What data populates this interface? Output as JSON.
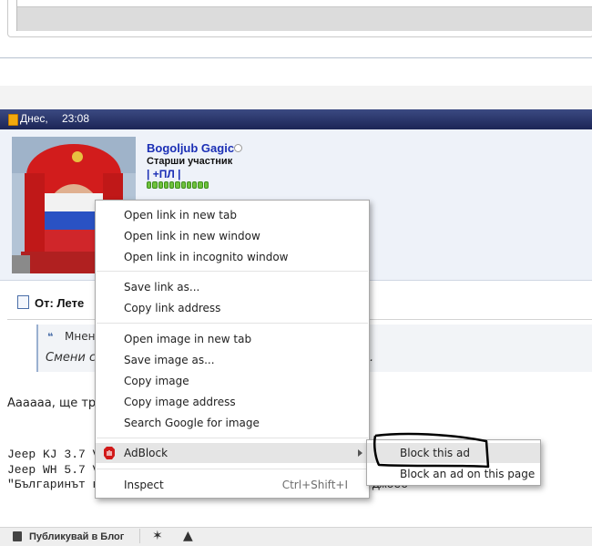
{
  "post": {
    "date_label": "Днес,",
    "time": "23:08",
    "username": "Bogoljub Gagic",
    "user_title": "Старши участник",
    "profile_link": "| +ПЛ |",
    "reputation_pips": 11,
    "title_visible": "От: Лете",
    "quote_label": "Мнен",
    "quote_text_left": "Смени с",
    "quote_text_right": "о.",
    "body_line1": "Аааааа, ще тр",
    "jeep_line1": "Jeep KJ 3.7 V",
    "jeep_line2": "Jeep WH 5.7 V",
    "bg_line": "\"Българинът н",
    "tail_text": "Джоео"
  },
  "bottom_bar": {
    "blog_label": "Публикувай в Блог"
  },
  "context_menu": {
    "open_new_tab": "Open link in new tab",
    "open_new_window": "Open link in new window",
    "open_incognito": "Open link in incognito window",
    "save_link": "Save link as...",
    "copy_link": "Copy link address",
    "open_image_tab": "Open image in new tab",
    "save_image": "Save image as...",
    "copy_image": "Copy image",
    "copy_image_address": "Copy image address",
    "search_google_image": "Search Google for image",
    "adblock": "AdBlock",
    "inspect": "Inspect",
    "inspect_shortcut": "Ctrl+Shift+I"
  },
  "submenu": {
    "block_this_ad": "Block this ad",
    "block_ad_on_page": "Block an ad on this page"
  },
  "colors": {
    "header_bar": "#1c2556",
    "username": "#1b2fb5",
    "highlight": "#e5e5e5",
    "adblock_red": "#d11a1a"
  }
}
